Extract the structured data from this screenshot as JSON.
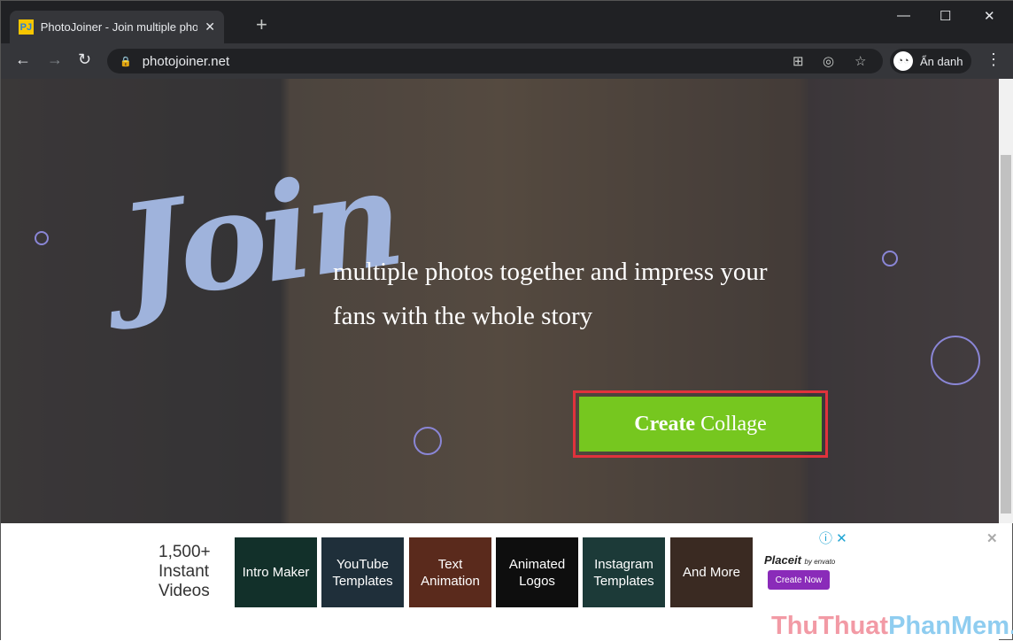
{
  "browser": {
    "tab_title": "PhotoJoiner - Join multiple photos together",
    "favicon": "PJ",
    "url": "photojoiner.net",
    "profile_label": "Ẩn danh"
  },
  "hero": {
    "headline": "Join",
    "tagline": "multiple photos together and impress your fans with the whole story",
    "cta_bold": "Create",
    "cta_rest": "Collage"
  },
  "ad": {
    "headline": [
      "1,500+",
      "Instant",
      "Videos"
    ],
    "tiles": [
      "Intro Maker",
      "YouTube Templates",
      "Text Animation",
      "Animated Logos",
      "Instagram Templates",
      "And More"
    ],
    "brand": "Placeit",
    "brand_by": "by envato",
    "cta": "Create Now"
  },
  "watermark": {
    "part1": "ThuThuat",
    "part2": "PhanMem.vn"
  },
  "colors": {
    "cta": "#76c71f",
    "highlight": "#e0323c",
    "ad_button": "#8a2bb9"
  }
}
